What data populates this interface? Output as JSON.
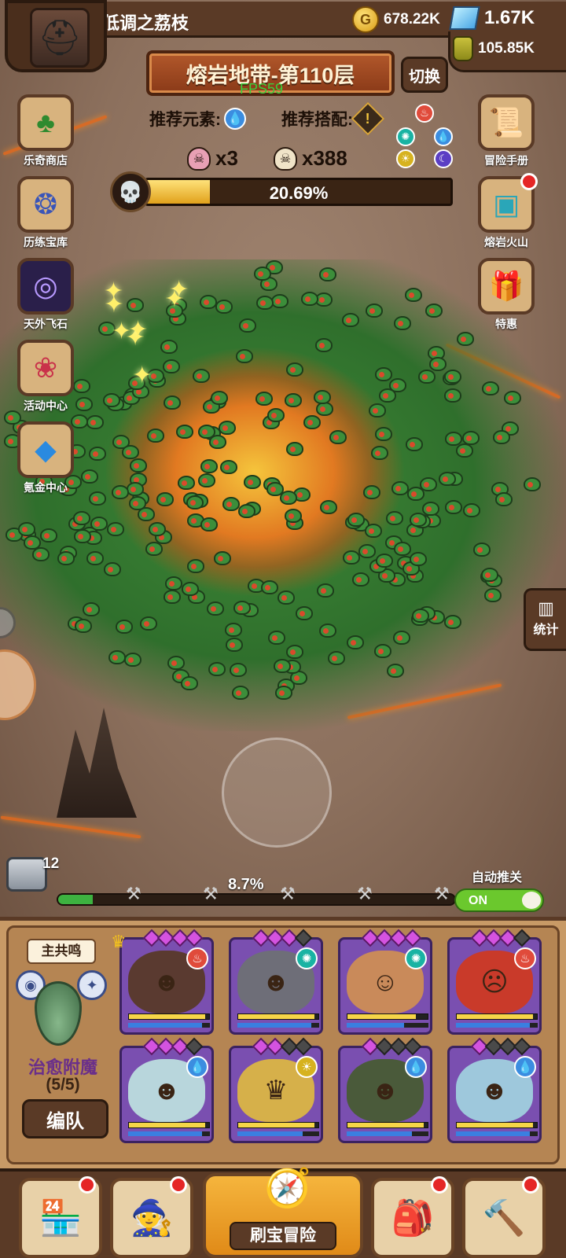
{
  "player": {
    "name": "低调之荔枝",
    "gold": "678.22K",
    "diamonds": "1.67K",
    "potion": "105.85K"
  },
  "level": {
    "title": "熔岩地带-第110层",
    "fps": "FPS59",
    "switch_label": "切换",
    "rec_element_label": "推荐元素:",
    "rec_combo_label": "推荐搭配:",
    "elite_count": "x3",
    "monster_count": "x388",
    "boss_progress_text": "20.69%",
    "boss_progress": 0.2069
  },
  "left_menu": [
    {
      "label": "乐奇商店",
      "icon": "clover-icon"
    },
    {
      "label": "历练宝库",
      "icon": "treasure-icon"
    },
    {
      "label": "天外飞石",
      "icon": "portal-icon"
    },
    {
      "label": "活动中心",
      "icon": "bouquet-icon"
    },
    {
      "label": "氪金中心",
      "icon": "diamond-icon"
    }
  ],
  "right_menu": [
    {
      "label": "冒险手册",
      "icon": "scroll-icon"
    },
    {
      "label": "熔岩火山",
      "icon": "chest-icon"
    },
    {
      "label": "特惠",
      "icon": "gift-box-icon"
    }
  ],
  "stats_label": "统计",
  "wave": {
    "chest_count": "12",
    "progress_text": "8.7%",
    "progress": 0.087,
    "auto_label": "自动推关",
    "toggle_label": "ON"
  },
  "team": {
    "resonance_label": "主共鸣",
    "enchant_name": "治愈附魔",
    "enchant_count": "(5/5)",
    "formation_label": "编队"
  },
  "heroes": [
    {
      "element": "fire",
      "stars": [
        1,
        1,
        1,
        1,
        0
      ],
      "hp": 0.95,
      "mp": 0.9
    },
    {
      "element": "wind",
      "stars": [
        1,
        1,
        1,
        0,
        0
      ],
      "hp": 0.95,
      "mp": 0.9
    },
    {
      "element": "wind",
      "stars": [
        1,
        1,
        1,
        1,
        0
      ],
      "hp": 0.85,
      "mp": 0.7
    },
    {
      "element": "fire",
      "stars": [
        1,
        1,
        1,
        0,
        0
      ],
      "hp": 0.95,
      "mp": 0.9
    },
    {
      "element": "water",
      "stars": [
        1,
        1,
        1,
        0,
        0
      ],
      "hp": 0.95,
      "mp": 0.9
    },
    {
      "element": "light",
      "stars": [
        1,
        1,
        0,
        0,
        0
      ],
      "hp": 0.95,
      "mp": 0.8
    },
    {
      "element": "water",
      "stars": [
        1,
        0,
        0,
        0,
        0
      ],
      "hp": 0.95,
      "mp": 0.8
    },
    {
      "element": "water",
      "stars": [
        1,
        0,
        0,
        0,
        0
      ],
      "hp": 0.95,
      "mp": 0.9
    }
  ],
  "bottom_nav": {
    "main_label": "刷宝冒险"
  },
  "colors": {
    "accent": "#e08a18",
    "frame": "#5a3a26",
    "hero_card": "#7a4fb0",
    "toggle_on": "#6bc82d"
  }
}
